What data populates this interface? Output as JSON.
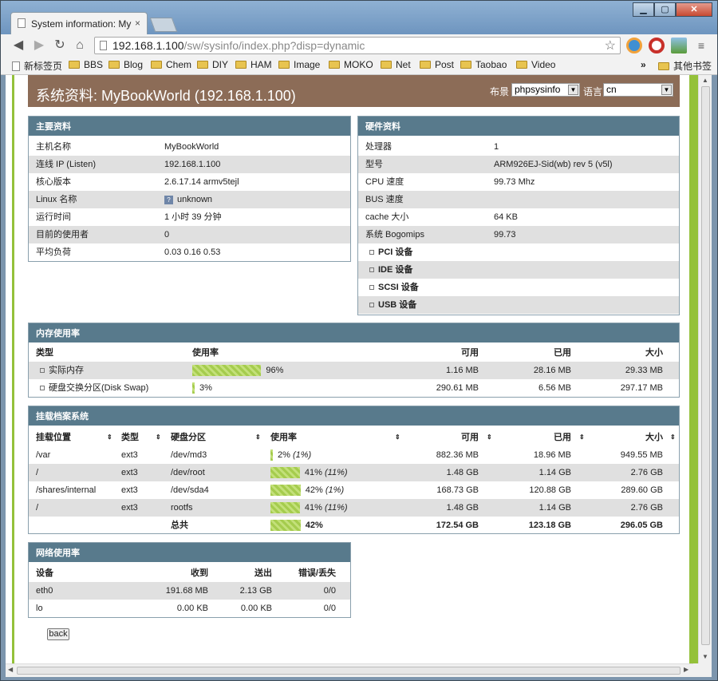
{
  "browser": {
    "tab_title": "System information: My",
    "url_host": "192.168.1.100",
    "url_path": "/sw/sysinfo/index.php?disp=dynamic",
    "bookmarks": [
      "新标签页",
      "BBS",
      "Blog",
      "Chem",
      "DIY",
      "HAM",
      "Image",
      "MOKO",
      "Net",
      "Post",
      "Taobao",
      "Video"
    ],
    "bookmarks_overflow": "»",
    "other_bookmarks": "其他书签"
  },
  "header": {
    "title": "系统资料: MyBookWorld (192.168.1.100)",
    "layout_label": "布景",
    "layout_value": "phpsysinfo",
    "lang_label": "语言",
    "lang_value": "cn"
  },
  "vitals": {
    "title": "主要资料",
    "rows": [
      {
        "label": "主机名称",
        "value": "MyBookWorld"
      },
      {
        "label": "连线 IP (Listen)",
        "value": "192.168.1.100"
      },
      {
        "label": "核心版本",
        "value": "2.6.17.14 armv5tejl"
      },
      {
        "label": "Linux 名称",
        "value": "unknown"
      },
      {
        "label": "运行时间",
        "value": "1 小时 39 分钟"
      },
      {
        "label": "目前的使用者",
        "value": "0"
      },
      {
        "label": "平均负荷",
        "value": "0.03 0.16 0.53"
      }
    ]
  },
  "hardware": {
    "title": "硬件资料",
    "rows": [
      {
        "label": "处理器",
        "value": "1"
      },
      {
        "label": "型号",
        "value": "ARM926EJ-Sid(wb) rev 5 (v5l)"
      },
      {
        "label": "CPU 速度",
        "value": "99.73 Mhz"
      },
      {
        "label": "BUS 速度",
        "value": ""
      },
      {
        "label": "cache 大小",
        "value": "64 KB"
      },
      {
        "label": "系统 Bogomips",
        "value": "99.73"
      }
    ],
    "devices": [
      "PCI 设备",
      "IDE 设备",
      "SCSI 设备",
      "USB 设备"
    ]
  },
  "memory": {
    "title": "内存使用率",
    "headers": {
      "type": "类型",
      "usage": "使用率",
      "free": "可用",
      "used": "已用",
      "size": "大小"
    },
    "rows": [
      {
        "type": "实际内存",
        "pct": 96,
        "pct_label": "96%",
        "free": "1.16 MB",
        "used": "28.16 MB",
        "size": "29.33 MB"
      },
      {
        "type": "硬盘交换分区(Disk Swap)",
        "pct": 3,
        "pct_label": "3%",
        "free": "290.61 MB",
        "used": "6.56 MB",
        "size": "297.17 MB"
      }
    ]
  },
  "filesystems": {
    "title": "挂载档案系统",
    "headers": {
      "mount": "挂载位置",
      "type": "类型",
      "partition": "硬盘分区",
      "usage": "使用率",
      "free": "可用",
      "used": "已用",
      "size": "大小"
    },
    "sort_icon": "⇕",
    "rows": [
      {
        "mount": "/var",
        "type": "ext3",
        "partition": "/dev/md3",
        "pct": 2,
        "pct_label": "2%",
        "inode": "(1%)",
        "free": "882.36 MB",
        "used": "18.96 MB",
        "size": "949.55 MB"
      },
      {
        "mount": "/",
        "type": "ext3",
        "partition": "/dev/root",
        "pct": 41,
        "pct_label": "41%",
        "inode": "(11%)",
        "free": "1.48 GB",
        "used": "1.14 GB",
        "size": "2.76 GB"
      },
      {
        "mount": "/shares/internal",
        "type": "ext3",
        "partition": "/dev/sda4",
        "pct": 42,
        "pct_label": "42%",
        "inode": "(1%)",
        "free": "168.73 GB",
        "used": "120.88 GB",
        "size": "289.60 GB"
      },
      {
        "mount": "/",
        "type": "ext3",
        "partition": "rootfs",
        "pct": 41,
        "pct_label": "41%",
        "inode": "(11%)",
        "free": "1.48 GB",
        "used": "1.14 GB",
        "size": "2.76 GB"
      }
    ],
    "total": {
      "label": "总共",
      "pct": 42,
      "pct_label": "42%",
      "free": "172.54 GB",
      "used": "123.18 GB",
      "size": "296.05 GB"
    }
  },
  "network": {
    "title": "网络使用率",
    "headers": {
      "device": "设备",
      "rx": "收到",
      "tx": "送出",
      "err": "错误/丢失"
    },
    "rows": [
      {
        "device": "eth0",
        "rx": "191.68 MB",
        "tx": "2.13 GB",
        "err": "0/0"
      },
      {
        "device": "lo",
        "rx": "0.00 KB",
        "tx": "0.00 KB",
        "err": "0/0"
      }
    ]
  },
  "back_label": "back",
  "colors": {
    "accent_green": "#94c13a",
    "header_brown": "#8c6c57",
    "box_header": "#587a8c",
    "row_alt": "#e0e0e0"
  }
}
